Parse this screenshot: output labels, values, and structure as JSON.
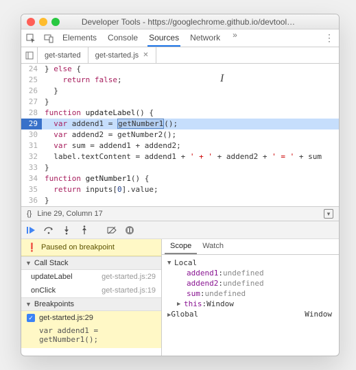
{
  "window": {
    "title": "Developer Tools - https://googlechrome.github.io/devtool…"
  },
  "main_tabs": {
    "items": [
      "Elements",
      "Console",
      "Sources",
      "Network"
    ],
    "active": "Sources",
    "more": "»"
  },
  "file_tabs": {
    "items": [
      "get-started",
      "get-started.js"
    ],
    "active": "get-started.js"
  },
  "editor": {
    "lines": [
      {
        "n": 24,
        "html": "} <span class='kw'>else</span> {"
      },
      {
        "n": 25,
        "html": "    <span class='kw'>return</span> <span class='kw'>false</span>;"
      },
      {
        "n": 26,
        "html": "  }"
      },
      {
        "n": 27,
        "html": "}"
      },
      {
        "n": 28,
        "html": "<span class='kw'>function</span> <span class='fn'>updateLabel</span>() {"
      },
      {
        "n": 29,
        "hl": true,
        "html": "  <span class='kw'>var</span> addend1 = <span class='selbox'>getNumber1</span>();"
      },
      {
        "n": 30,
        "html": "  <span class='kw'>var</span> addend2 = getNumber2();"
      },
      {
        "n": 31,
        "html": "  <span class='kw'>var</span> sum = addend1 + addend2;"
      },
      {
        "n": 32,
        "html": "  label.textContent = addend1 + <span class='str'>' + '</span> + addend2 + <span class='str'>' = '</span> + sum"
      },
      {
        "n": 33,
        "html": "}"
      },
      {
        "n": 34,
        "html": "<span class='kw'>function</span> <span class='fn'>getNumber1</span>() {"
      },
      {
        "n": 35,
        "html": "  <span class='kw'>return</span> inputs[<span class='num'>0</span>].value;"
      },
      {
        "n": 36,
        "html": "}"
      }
    ]
  },
  "status": {
    "line_col": "Line 29, Column 17",
    "braces": "{}"
  },
  "debug": {
    "paused": "Paused on breakpoint",
    "call_stack_header": "Call Stack",
    "stack": [
      {
        "fn": "updateLabel",
        "loc": "get-started.js:29"
      },
      {
        "fn": "onClick",
        "loc": "get-started.js:19"
      }
    ],
    "breakpoints_header": "Breakpoints",
    "bp": {
      "label": "get-started.js:29",
      "code": "var addend1 = getNumber1();"
    }
  },
  "scope": {
    "tabs": [
      "Scope",
      "Watch"
    ],
    "active": "Scope",
    "local_label": "Local",
    "locals": [
      {
        "name": "addend1",
        "value": "undefined"
      },
      {
        "name": "addend2",
        "value": "undefined"
      },
      {
        "name": "sum",
        "value": "undefined"
      }
    ],
    "this_label": "this",
    "this_value": "Window",
    "global_label": "Global",
    "global_value": "Window"
  }
}
